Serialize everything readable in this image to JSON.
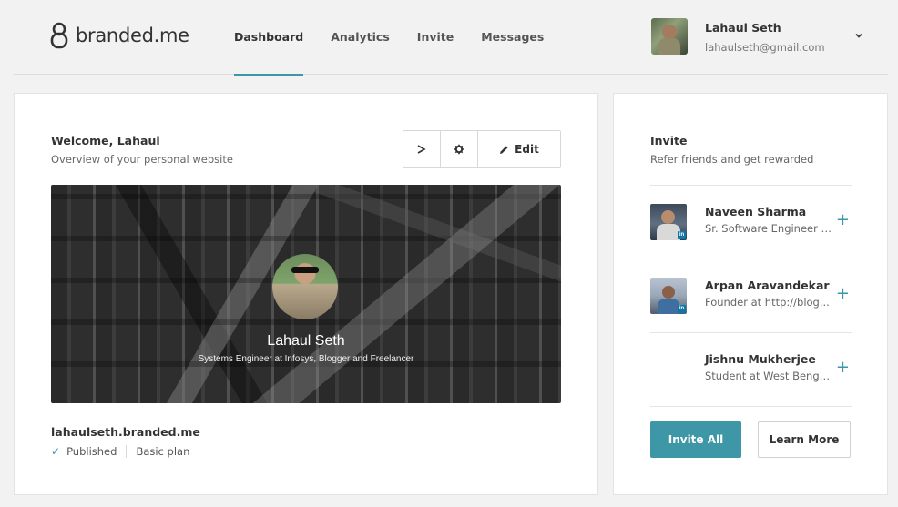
{
  "brand": {
    "name": "branded.me",
    "icon": "lock-logo-icon"
  },
  "nav": {
    "items": [
      {
        "label": "Dashboard",
        "active": true
      },
      {
        "label": "Analytics",
        "active": false
      },
      {
        "label": "Invite",
        "active": false
      },
      {
        "label": "Messages",
        "active": false
      }
    ]
  },
  "user": {
    "name": "Lahaul Seth",
    "email": "lahaulseth@gmail.com"
  },
  "welcome": {
    "title": "Welcome, Lahaul",
    "subtitle": "Overview of your personal website",
    "toolbar": {
      "edit_label": "Edit"
    }
  },
  "preview": {
    "name": "Lahaul Seth",
    "tagline": "Systems Engineer at Infosys, Blogger and Freelancer"
  },
  "site": {
    "url": "lahaulseth.branded.me",
    "status": "Published",
    "plan": "Basic plan"
  },
  "invite": {
    "title": "Invite",
    "subtitle": "Refer friends and get rewarded",
    "contacts": [
      {
        "name": "Naveen Sharma",
        "title": "Sr. Software Engineer at..."
      },
      {
        "name": "Arpan Aravandekar",
        "title": "Founder at http://blog..."
      },
      {
        "name": "Jishnu Mukherjee",
        "title": "Student at West Bengal..."
      }
    ],
    "invite_all_label": "Invite All",
    "learn_more_label": "Learn More"
  },
  "colors": {
    "accent": "#3e97a6",
    "background": "#f2f2f2",
    "linkedin": "#0e76a8"
  }
}
